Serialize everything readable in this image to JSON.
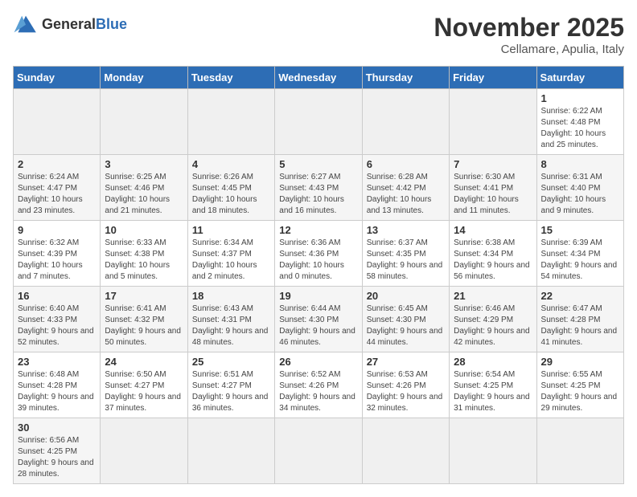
{
  "logo": {
    "text_general": "General",
    "text_blue": "Blue"
  },
  "header": {
    "month_year": "November 2025",
    "location": "Cellamare, Apulia, Italy"
  },
  "weekdays": [
    "Sunday",
    "Monday",
    "Tuesday",
    "Wednesday",
    "Thursday",
    "Friday",
    "Saturday"
  ],
  "weeks": [
    [
      {
        "day": "",
        "info": "",
        "empty": true
      },
      {
        "day": "",
        "info": "",
        "empty": true
      },
      {
        "day": "",
        "info": "",
        "empty": true
      },
      {
        "day": "",
        "info": "",
        "empty": true
      },
      {
        "day": "",
        "info": "",
        "empty": true
      },
      {
        "day": "",
        "info": "",
        "empty": true
      },
      {
        "day": "1",
        "info": "Sunrise: 6:22 AM\nSunset: 4:48 PM\nDaylight: 10 hours and 25 minutes.",
        "empty": false
      }
    ],
    [
      {
        "day": "2",
        "info": "Sunrise: 6:24 AM\nSunset: 4:47 PM\nDaylight: 10 hours and 23 minutes.",
        "empty": false
      },
      {
        "day": "3",
        "info": "Sunrise: 6:25 AM\nSunset: 4:46 PM\nDaylight: 10 hours and 21 minutes.",
        "empty": false
      },
      {
        "day": "4",
        "info": "Sunrise: 6:26 AM\nSunset: 4:45 PM\nDaylight: 10 hours and 18 minutes.",
        "empty": false
      },
      {
        "day": "5",
        "info": "Sunrise: 6:27 AM\nSunset: 4:43 PM\nDaylight: 10 hours and 16 minutes.",
        "empty": false
      },
      {
        "day": "6",
        "info": "Sunrise: 6:28 AM\nSunset: 4:42 PM\nDaylight: 10 hours and 13 minutes.",
        "empty": false
      },
      {
        "day": "7",
        "info": "Sunrise: 6:30 AM\nSunset: 4:41 PM\nDaylight: 10 hours and 11 minutes.",
        "empty": false
      },
      {
        "day": "8",
        "info": "Sunrise: 6:31 AM\nSunset: 4:40 PM\nDaylight: 10 hours and 9 minutes.",
        "empty": false
      }
    ],
    [
      {
        "day": "9",
        "info": "Sunrise: 6:32 AM\nSunset: 4:39 PM\nDaylight: 10 hours and 7 minutes.",
        "empty": false
      },
      {
        "day": "10",
        "info": "Sunrise: 6:33 AM\nSunset: 4:38 PM\nDaylight: 10 hours and 5 minutes.",
        "empty": false
      },
      {
        "day": "11",
        "info": "Sunrise: 6:34 AM\nSunset: 4:37 PM\nDaylight: 10 hours and 2 minutes.",
        "empty": false
      },
      {
        "day": "12",
        "info": "Sunrise: 6:36 AM\nSunset: 4:36 PM\nDaylight: 10 hours and 0 minutes.",
        "empty": false
      },
      {
        "day": "13",
        "info": "Sunrise: 6:37 AM\nSunset: 4:35 PM\nDaylight: 9 hours and 58 minutes.",
        "empty": false
      },
      {
        "day": "14",
        "info": "Sunrise: 6:38 AM\nSunset: 4:34 PM\nDaylight: 9 hours and 56 minutes.",
        "empty": false
      },
      {
        "day": "15",
        "info": "Sunrise: 6:39 AM\nSunset: 4:34 PM\nDaylight: 9 hours and 54 minutes.",
        "empty": false
      }
    ],
    [
      {
        "day": "16",
        "info": "Sunrise: 6:40 AM\nSunset: 4:33 PM\nDaylight: 9 hours and 52 minutes.",
        "empty": false
      },
      {
        "day": "17",
        "info": "Sunrise: 6:41 AM\nSunset: 4:32 PM\nDaylight: 9 hours and 50 minutes.",
        "empty": false
      },
      {
        "day": "18",
        "info": "Sunrise: 6:43 AM\nSunset: 4:31 PM\nDaylight: 9 hours and 48 minutes.",
        "empty": false
      },
      {
        "day": "19",
        "info": "Sunrise: 6:44 AM\nSunset: 4:30 PM\nDaylight: 9 hours and 46 minutes.",
        "empty": false
      },
      {
        "day": "20",
        "info": "Sunrise: 6:45 AM\nSunset: 4:30 PM\nDaylight: 9 hours and 44 minutes.",
        "empty": false
      },
      {
        "day": "21",
        "info": "Sunrise: 6:46 AM\nSunset: 4:29 PM\nDaylight: 9 hours and 42 minutes.",
        "empty": false
      },
      {
        "day": "22",
        "info": "Sunrise: 6:47 AM\nSunset: 4:28 PM\nDaylight: 9 hours and 41 minutes.",
        "empty": false
      }
    ],
    [
      {
        "day": "23",
        "info": "Sunrise: 6:48 AM\nSunset: 4:28 PM\nDaylight: 9 hours and 39 minutes.",
        "empty": false
      },
      {
        "day": "24",
        "info": "Sunrise: 6:50 AM\nSunset: 4:27 PM\nDaylight: 9 hours and 37 minutes.",
        "empty": false
      },
      {
        "day": "25",
        "info": "Sunrise: 6:51 AM\nSunset: 4:27 PM\nDaylight: 9 hours and 36 minutes.",
        "empty": false
      },
      {
        "day": "26",
        "info": "Sunrise: 6:52 AM\nSunset: 4:26 PM\nDaylight: 9 hours and 34 minutes.",
        "empty": false
      },
      {
        "day": "27",
        "info": "Sunrise: 6:53 AM\nSunset: 4:26 PM\nDaylight: 9 hours and 32 minutes.",
        "empty": false
      },
      {
        "day": "28",
        "info": "Sunrise: 6:54 AM\nSunset: 4:25 PM\nDaylight: 9 hours and 31 minutes.",
        "empty": false
      },
      {
        "day": "29",
        "info": "Sunrise: 6:55 AM\nSunset: 4:25 PM\nDaylight: 9 hours and 29 minutes.",
        "empty": false
      }
    ],
    [
      {
        "day": "30",
        "info": "Sunrise: 6:56 AM\nSunset: 4:25 PM\nDaylight: 9 hours and 28 minutes.",
        "empty": false
      },
      {
        "day": "",
        "info": "",
        "empty": true
      },
      {
        "day": "",
        "info": "",
        "empty": true
      },
      {
        "day": "",
        "info": "",
        "empty": true
      },
      {
        "day": "",
        "info": "",
        "empty": true
      },
      {
        "day": "",
        "info": "",
        "empty": true
      },
      {
        "day": "",
        "info": "",
        "empty": true
      }
    ]
  ]
}
